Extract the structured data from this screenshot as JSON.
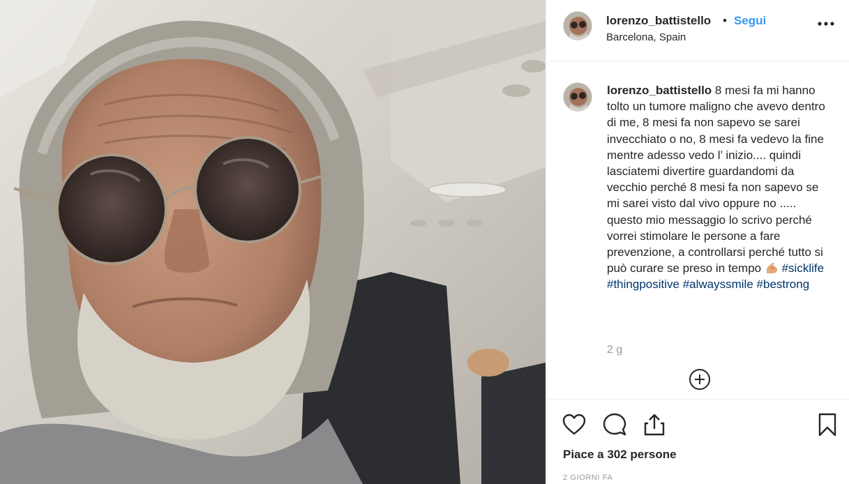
{
  "post": {
    "username": "lorenzo_battistello",
    "separator": "•",
    "follow_label": "Segui",
    "location": "Barcelona, Spain",
    "more_icon": "more-horizontal-icon",
    "photo_alt": "selfie-photo"
  },
  "caption": {
    "username": "lorenzo_battistello",
    "text": "8 mesi fa mi hanno tolto un tumore maligno che avevo dentro di me, 8 mesi fa non sapevo se sarei invecchiato o no, 8 mesi fa vedevo la fine mentre adesso vedo l’ inizio.... quindi lasciatemi divertire guardandomi da vecchio perché 8 mesi fa non sapevo se mi sarei visto dal vivo oppure no ..... questo mio messaggio lo scrivo perché vorrei stimolare le persone a fare prevenzione, a controllarsi perché tutto si può curare se preso in tempo",
    "emoji": "flexed-biceps-emoji",
    "hashtags": [
      "#sicklife",
      "#thingpositive",
      "#alwayssmile",
      "#bestrong"
    ],
    "time_ago": "2 g",
    "load_more_icon": "plus-circle-icon"
  },
  "actions": {
    "like_icon": "heart-icon",
    "comment_icon": "comment-icon",
    "share_icon": "share-icon",
    "save_icon": "bookmark-icon"
  },
  "likes_text": "Piace a 302 persone",
  "posted_ago": "2 GIORNI FA",
  "colors": {
    "link_blue": "#3897f0",
    "hashtag": "#003569",
    "muted": "#999999",
    "border": "#efefef"
  }
}
